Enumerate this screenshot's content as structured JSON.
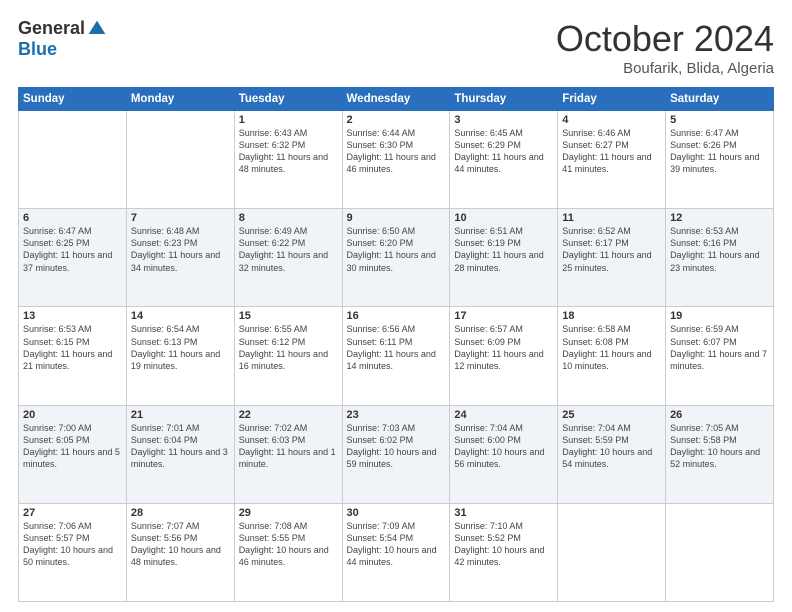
{
  "logo": {
    "general": "General",
    "blue": "Blue"
  },
  "title": "October 2024",
  "subtitle": "Boufarik, Blida, Algeria",
  "days_header": [
    "Sunday",
    "Monday",
    "Tuesday",
    "Wednesday",
    "Thursday",
    "Friday",
    "Saturday"
  ],
  "weeks": [
    [
      {
        "day": "",
        "info": ""
      },
      {
        "day": "",
        "info": ""
      },
      {
        "day": "1",
        "info": "Sunrise: 6:43 AM\nSunset: 6:32 PM\nDaylight: 11 hours and 48 minutes."
      },
      {
        "day": "2",
        "info": "Sunrise: 6:44 AM\nSunset: 6:30 PM\nDaylight: 11 hours and 46 minutes."
      },
      {
        "day": "3",
        "info": "Sunrise: 6:45 AM\nSunset: 6:29 PM\nDaylight: 11 hours and 44 minutes."
      },
      {
        "day": "4",
        "info": "Sunrise: 6:46 AM\nSunset: 6:27 PM\nDaylight: 11 hours and 41 minutes."
      },
      {
        "day": "5",
        "info": "Sunrise: 6:47 AM\nSunset: 6:26 PM\nDaylight: 11 hours and 39 minutes."
      }
    ],
    [
      {
        "day": "6",
        "info": "Sunrise: 6:47 AM\nSunset: 6:25 PM\nDaylight: 11 hours and 37 minutes."
      },
      {
        "day": "7",
        "info": "Sunrise: 6:48 AM\nSunset: 6:23 PM\nDaylight: 11 hours and 34 minutes."
      },
      {
        "day": "8",
        "info": "Sunrise: 6:49 AM\nSunset: 6:22 PM\nDaylight: 11 hours and 32 minutes."
      },
      {
        "day": "9",
        "info": "Sunrise: 6:50 AM\nSunset: 6:20 PM\nDaylight: 11 hours and 30 minutes."
      },
      {
        "day": "10",
        "info": "Sunrise: 6:51 AM\nSunset: 6:19 PM\nDaylight: 11 hours and 28 minutes."
      },
      {
        "day": "11",
        "info": "Sunrise: 6:52 AM\nSunset: 6:17 PM\nDaylight: 11 hours and 25 minutes."
      },
      {
        "day": "12",
        "info": "Sunrise: 6:53 AM\nSunset: 6:16 PM\nDaylight: 11 hours and 23 minutes."
      }
    ],
    [
      {
        "day": "13",
        "info": "Sunrise: 6:53 AM\nSunset: 6:15 PM\nDaylight: 11 hours and 21 minutes."
      },
      {
        "day": "14",
        "info": "Sunrise: 6:54 AM\nSunset: 6:13 PM\nDaylight: 11 hours and 19 minutes."
      },
      {
        "day": "15",
        "info": "Sunrise: 6:55 AM\nSunset: 6:12 PM\nDaylight: 11 hours and 16 minutes."
      },
      {
        "day": "16",
        "info": "Sunrise: 6:56 AM\nSunset: 6:11 PM\nDaylight: 11 hours and 14 minutes."
      },
      {
        "day": "17",
        "info": "Sunrise: 6:57 AM\nSunset: 6:09 PM\nDaylight: 11 hours and 12 minutes."
      },
      {
        "day": "18",
        "info": "Sunrise: 6:58 AM\nSunset: 6:08 PM\nDaylight: 11 hours and 10 minutes."
      },
      {
        "day": "19",
        "info": "Sunrise: 6:59 AM\nSunset: 6:07 PM\nDaylight: 11 hours and 7 minutes."
      }
    ],
    [
      {
        "day": "20",
        "info": "Sunrise: 7:00 AM\nSunset: 6:05 PM\nDaylight: 11 hours and 5 minutes."
      },
      {
        "day": "21",
        "info": "Sunrise: 7:01 AM\nSunset: 6:04 PM\nDaylight: 11 hours and 3 minutes."
      },
      {
        "day": "22",
        "info": "Sunrise: 7:02 AM\nSunset: 6:03 PM\nDaylight: 11 hours and 1 minute."
      },
      {
        "day": "23",
        "info": "Sunrise: 7:03 AM\nSunset: 6:02 PM\nDaylight: 10 hours and 59 minutes."
      },
      {
        "day": "24",
        "info": "Sunrise: 7:04 AM\nSunset: 6:00 PM\nDaylight: 10 hours and 56 minutes."
      },
      {
        "day": "25",
        "info": "Sunrise: 7:04 AM\nSunset: 5:59 PM\nDaylight: 10 hours and 54 minutes."
      },
      {
        "day": "26",
        "info": "Sunrise: 7:05 AM\nSunset: 5:58 PM\nDaylight: 10 hours and 52 minutes."
      }
    ],
    [
      {
        "day": "27",
        "info": "Sunrise: 7:06 AM\nSunset: 5:57 PM\nDaylight: 10 hours and 50 minutes."
      },
      {
        "day": "28",
        "info": "Sunrise: 7:07 AM\nSunset: 5:56 PM\nDaylight: 10 hours and 48 minutes."
      },
      {
        "day": "29",
        "info": "Sunrise: 7:08 AM\nSunset: 5:55 PM\nDaylight: 10 hours and 46 minutes."
      },
      {
        "day": "30",
        "info": "Sunrise: 7:09 AM\nSunset: 5:54 PM\nDaylight: 10 hours and 44 minutes."
      },
      {
        "day": "31",
        "info": "Sunrise: 7:10 AM\nSunset: 5:52 PM\nDaylight: 10 hours and 42 minutes."
      },
      {
        "day": "",
        "info": ""
      },
      {
        "day": "",
        "info": ""
      }
    ]
  ]
}
